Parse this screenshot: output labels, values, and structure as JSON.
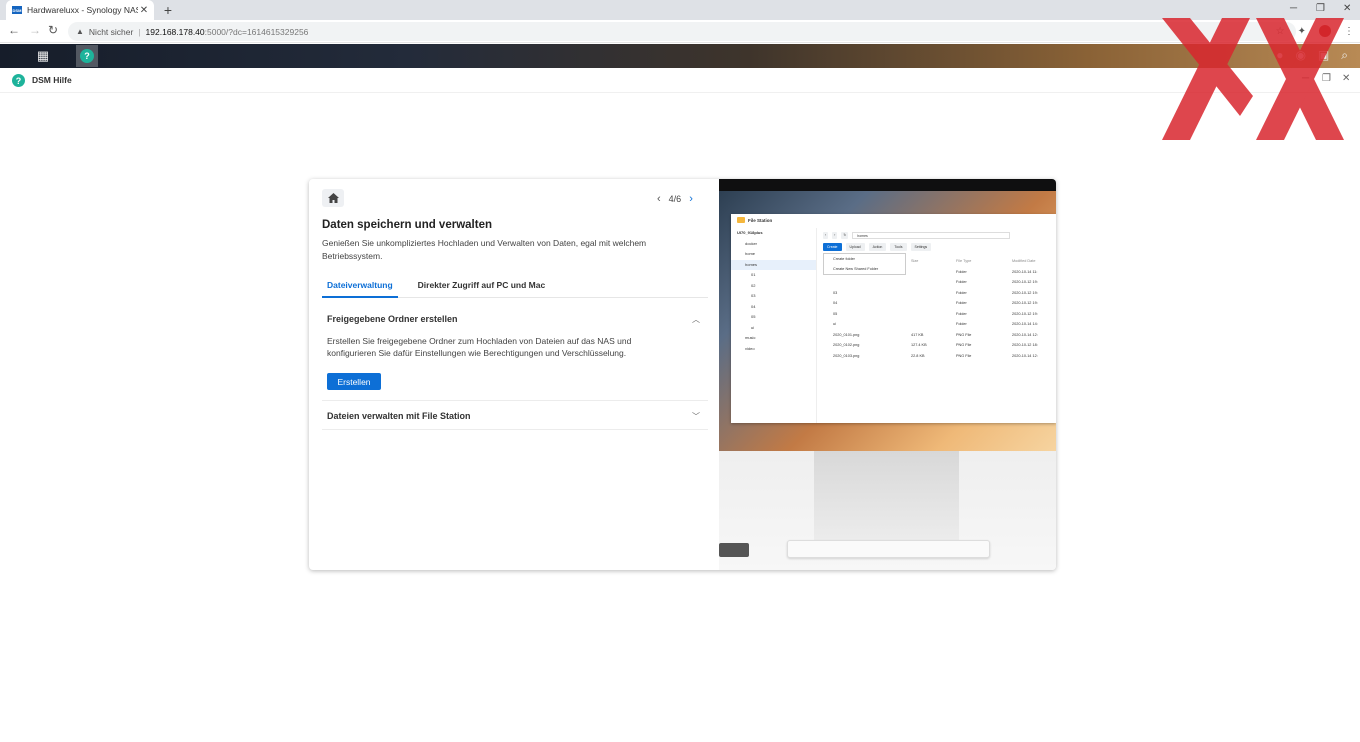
{
  "browser": {
    "tab_title": "Hardwareluxx - Synology NAS",
    "tab_favicon_text": "DSM",
    "new_tab_glyph": "+",
    "address": {
      "security": "Nicht sicher",
      "host": "192.168.178.40",
      "path": ":5000/?dc=1614615329256"
    }
  },
  "dsm": {
    "window_title": "DSM Hilfe"
  },
  "help": {
    "pager": "4/6",
    "heading": "Daten speichern und verwalten",
    "description": "Genießen Sie unkompliziertes Hochladen und Verwalten von Daten, egal mit welchem Betriebssystem.",
    "tabs": [
      {
        "label": "Dateiverwaltung",
        "active": true
      },
      {
        "label": "Direkter Zugriff auf PC und Mac",
        "active": false
      }
    ],
    "sections": [
      {
        "title": "Freigegebene Ordner erstellen",
        "expanded": true,
        "body": "Erstellen Sie freigegebene Ordner zum Hochladen von Dateien auf das NAS und konfigurieren Sie dafür Einstellungen wie Berechtigungen und Verschlüsselung.",
        "button": "Erstellen"
      },
      {
        "title": "Dateien verwalten mit File Station",
        "expanded": false
      }
    ]
  },
  "illustration": {
    "app_title": "File Station",
    "tree": [
      "UI70_918plus",
      "docker",
      "home",
      "homes",
      "01",
      "02",
      "03",
      "04",
      "05",
      "ui",
      "music",
      "video"
    ],
    "toolbar_path": "homes",
    "actions": [
      "Create",
      "Upload",
      "Action",
      "Tools",
      "Settings"
    ],
    "menu": [
      "Create folder",
      "Create New Shared Folder"
    ],
    "columns": [
      "",
      "Size",
      "File Type",
      "Modified Date"
    ],
    "rows": [
      [
        "",
        "",
        "Folder",
        "2020-10-14 11:"
      ],
      [
        "",
        "",
        "Folder",
        "2020-10-12 19:"
      ],
      [
        "03",
        "",
        "Folder",
        "2020-10-12 19:"
      ],
      [
        "04",
        "",
        "Folder",
        "2020-10-12 19:"
      ],
      [
        "05",
        "",
        "Folder",
        "2020-10-12 19:"
      ],
      [
        "ui",
        "",
        "Folder",
        "2020-10-14 14:"
      ],
      [
        "2020_0101.png",
        "417 KB",
        "PNG File",
        "2020-10-14 12:"
      ],
      [
        "2020_0102.png",
        "127.4 KB",
        "PNG File",
        "2020-10-12 18:"
      ],
      [
        "2020_0103.png",
        "22.8 KB",
        "PNG File",
        "2020-10-14 12:"
      ]
    ]
  },
  "colors": {
    "accent": "#0d6fd6",
    "app_icon": "#1eb39b",
    "logo_red": "#d9262e"
  }
}
